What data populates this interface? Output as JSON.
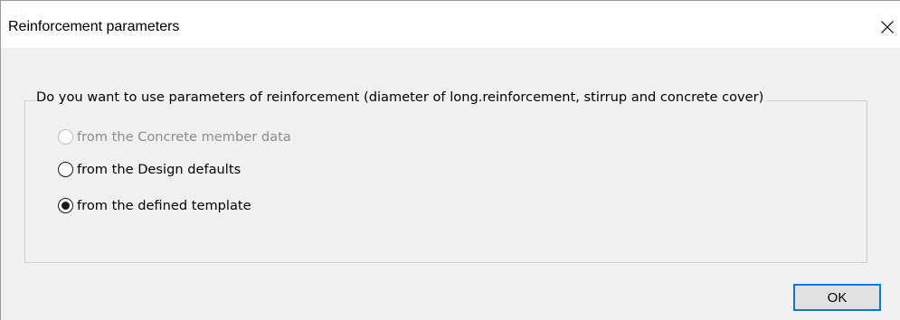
{
  "window": {
    "title": "Reinforcement parameters",
    "close_icon": "close-icon"
  },
  "group": {
    "caption": "Do you want to use parameters of reinforcement (diameter of long.reinforcement, stirrup and concrete cover)"
  },
  "options": [
    {
      "label": "from the Concrete member data",
      "selected": false,
      "enabled": false
    },
    {
      "label": "from the Design defaults",
      "selected": false,
      "enabled": true
    },
    {
      "label": "from the defined template",
      "selected": true,
      "enabled": true
    }
  ],
  "buttons": {
    "ok_label": "OK"
  },
  "colors": {
    "accent": "#0078d7",
    "dialog_bg": "#f0f0f0",
    "titlebar_bg": "#ffffff",
    "disabled_text": "#8c8c8c"
  }
}
